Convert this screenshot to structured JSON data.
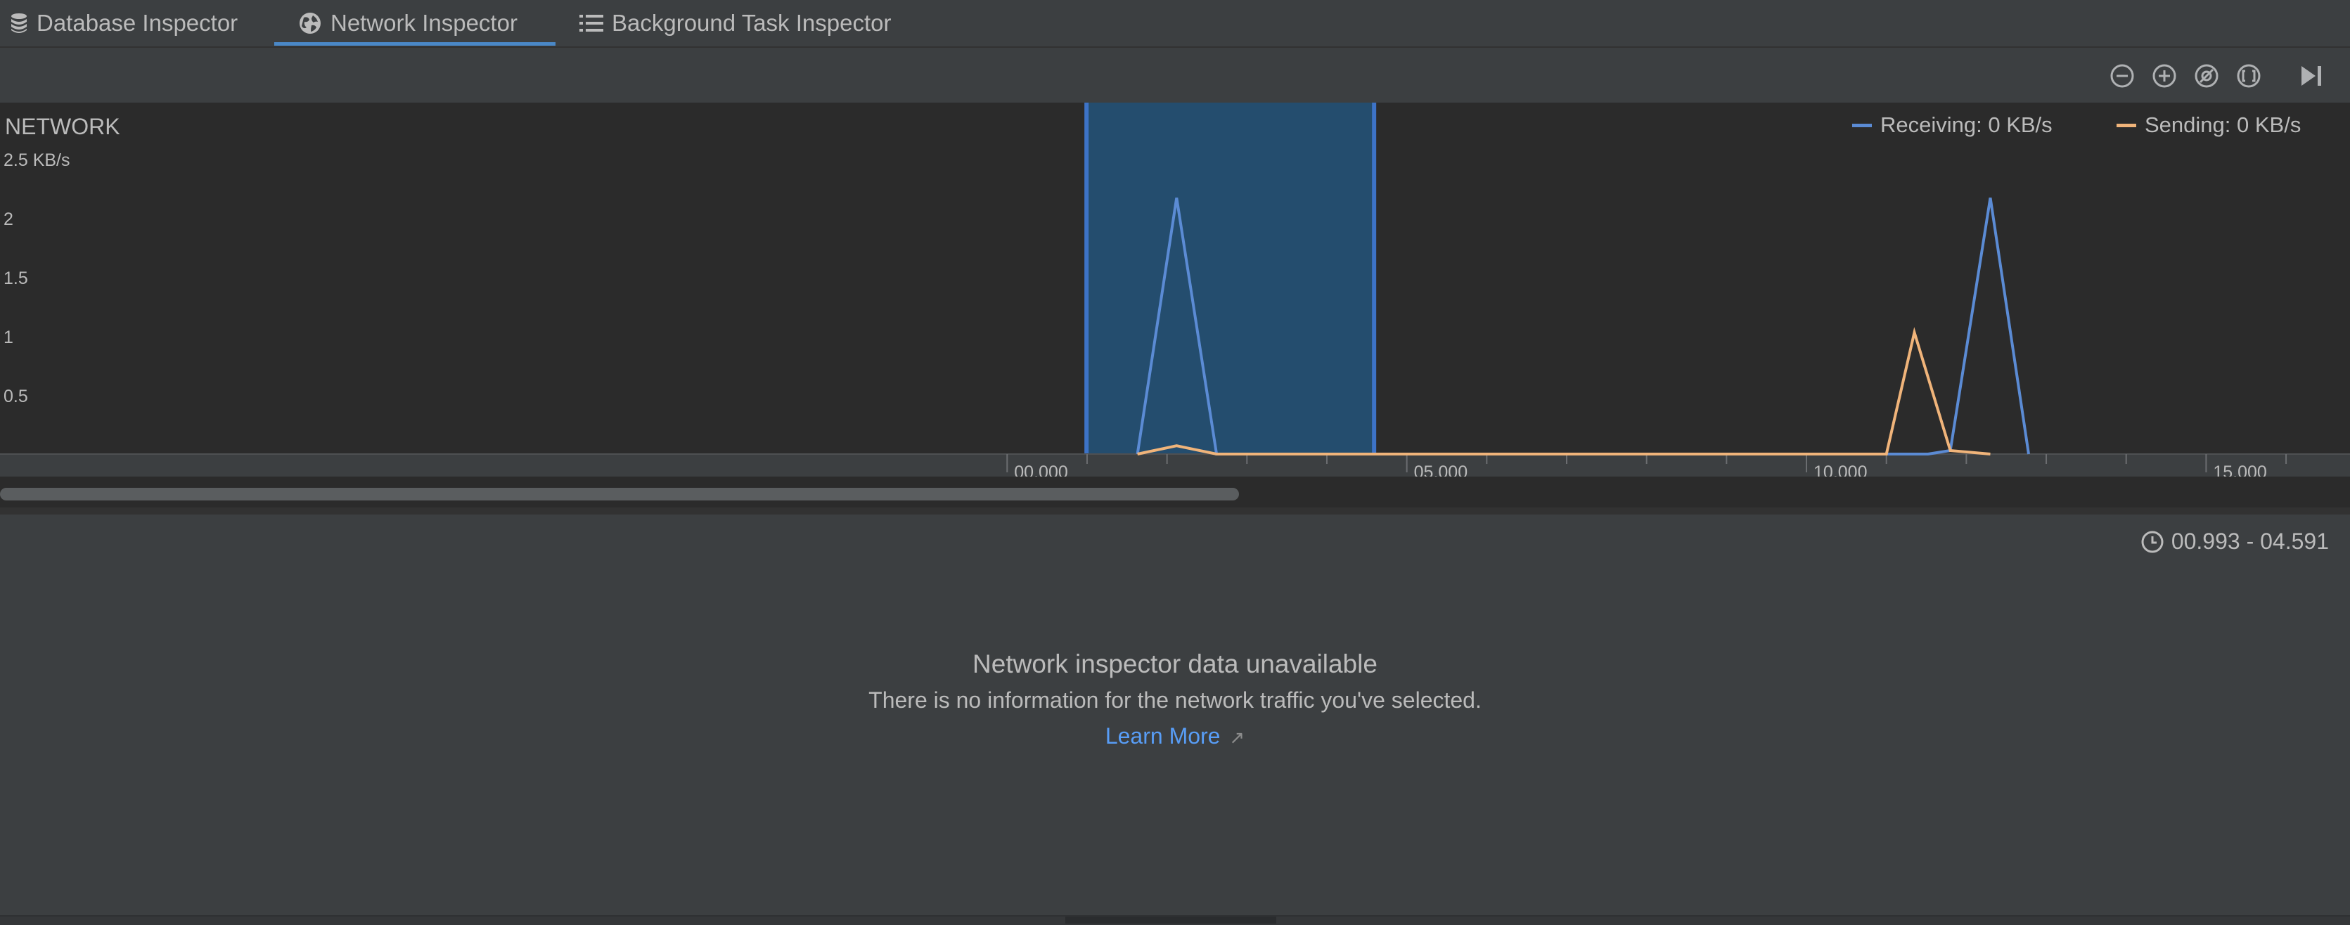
{
  "tabs": [
    {
      "label": "Database Inspector",
      "icon": "database-icon",
      "active": false
    },
    {
      "label": "Network Inspector",
      "icon": "globe-icon",
      "active": true
    },
    {
      "label": "Background Task Inspector",
      "icon": "list-icon",
      "active": false
    }
  ],
  "toolbar": {
    "buttons": [
      "zoom-out-icon",
      "zoom-in-icon",
      "reset-zoom-icon",
      "zoom-to-selection-icon",
      "go-to-live-icon"
    ]
  },
  "chart_data": {
    "type": "line",
    "title": "NETWORK",
    "unit": "KB/s",
    "y_ticks": [
      "2.5 KB/s",
      "2",
      "1.5",
      "1",
      "0.5"
    ],
    "y_tick_values": [
      2.5,
      2,
      1.5,
      1,
      0.5
    ],
    "ylim": [
      0,
      2.5
    ],
    "x_ticks": [
      "00.000",
      "05.000",
      "10.000",
      "15.000"
    ],
    "x_tick_values": [
      0,
      5,
      10,
      15
    ],
    "xlim": [
      -12.6,
      16.8
    ],
    "legend": [
      {
        "label": "Receiving: 0 KB/s",
        "color": "#5b8bd4"
      },
      {
        "label": "Sending: 0 KB/s",
        "color": "#f0b47a"
      }
    ],
    "legend_position": "top-right",
    "selection_range": [
      0.993,
      4.591
    ],
    "series": [
      {
        "name": "Receiving",
        "color": "#5b8bd4",
        "x": [
          1.63,
          2.12,
          2.62,
          11.52,
          11.8,
          12.3,
          12.78
        ],
        "y": [
          0,
          2.17,
          0,
          0,
          0.03,
          2.17,
          0
        ]
      },
      {
        "name": "Sending",
        "color": "#f0b47a",
        "x": [
          1.63,
          2.12,
          2.62,
          11.0,
          11.35,
          11.8,
          12.3
        ],
        "y": [
          0,
          0.07,
          0,
          0,
          1.03,
          0.03,
          0
        ]
      }
    ]
  },
  "details": {
    "time_range": "00.993 - 04.591",
    "title": "Network inspector data unavailable",
    "message": "There is no information for the network traffic you've selected.",
    "link": "Learn More",
    "link_arrow": "↗"
  },
  "colors": {
    "accent": "#4a88c7",
    "selection": "#244d6e",
    "link": "#589df6"
  }
}
